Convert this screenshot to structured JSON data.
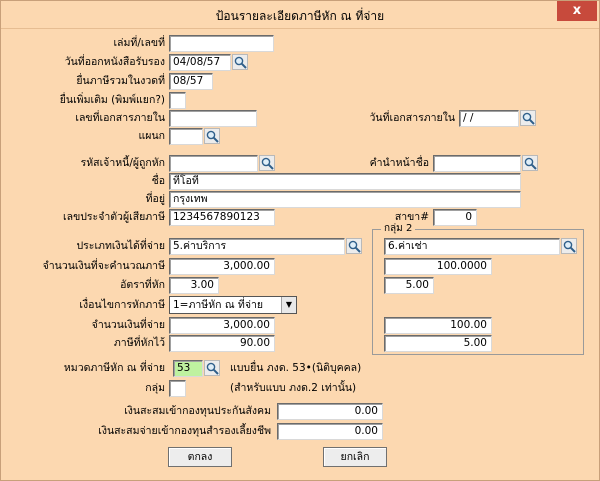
{
  "window": {
    "title": "ป้อนรายละเอียดภาษีหัก ณ ที่จ่าย",
    "close_glyph": "x"
  },
  "form": {
    "book_no": {
      "label": "เล่มที่/เลขที่",
      "value": ""
    },
    "cert_date": {
      "label": "วันที่ออกหนังสือรับรอง",
      "value": "04/08/57"
    },
    "filing_period": {
      "label": "ยื่นภาษีรวมในงวดที่",
      "value": "08/57"
    },
    "additional_filing": {
      "label": "ยื่นเพิ่มเติม (พิมพ์แยก?)",
      "value": ""
    },
    "internal_doc_no": {
      "label": "เลขที่เอกสารภายใน",
      "value": ""
    },
    "internal_doc_date": {
      "label": "วันที่เอกสารภายใน",
      "value": " / /"
    },
    "department": {
      "label": "แผนก",
      "value": ""
    },
    "payee_code": {
      "label": "รหัสเจ้าหนี้/ผู้ถูกหัก",
      "value": ""
    },
    "name_prefix": {
      "label": "คำนำหน้าชื่อ",
      "value": ""
    },
    "name": {
      "label": "ชื่อ",
      "value": "ทีโอที"
    },
    "address": {
      "label": "ที่อยู่",
      "value": "กรุงเทพ"
    },
    "tax_id": {
      "label": "เลขประจำตัวผู้เสียภาษี",
      "value": "1234567890123"
    },
    "branch": {
      "label": "สาขา#",
      "value": "0"
    },
    "income_type": {
      "label": "ประเภทเงินได้ที่จ่าย",
      "value": "5.ค่าบริการ"
    },
    "taxable_amount": {
      "label": "จำนวนเงินที่จะคำนวณภาษี",
      "value": "3,000.00"
    },
    "tax_rate": {
      "label": "อัตราที่หัก",
      "value": "3.00"
    },
    "withholding_condition": {
      "label": "เงื่อนไขการหักภาษี",
      "value": "1=ภาษีหัก ณ ที่จ่าย"
    },
    "paid_amount": {
      "label": "จำนวนเงินที่จ่าย",
      "value": "3,000.00"
    },
    "tax_withheld": {
      "label": "ภาษีที่หักไว้",
      "value": "90.00"
    },
    "tax_category": {
      "label": "หมวดภาษีหัก ณ ที่จ่าย",
      "value": "53",
      "note": "แบบยื่น ภงด. 53•(นิติบุคคล)"
    },
    "group": {
      "label": "กลุ่ม",
      "value": "",
      "note": "(สำหรับแบบ ภงด.2 เท่านั้น)"
    },
    "social_security": {
      "label": "เงินสะสมเข้ากองทุนประกันสังคม",
      "value": "0.00"
    },
    "provident_fund": {
      "label": "เงินสะสมจ่ายเข้ากองทุนสำรองเลี้ยงชีพ",
      "value": "0.00"
    }
  },
  "group2": {
    "title": "กลุ่ม 2",
    "income_type": "6.ค่าเช่า",
    "taxable_amount": "100.0000",
    "tax_rate": "5.00",
    "paid_amount": "100.00",
    "tax_withheld": "5.00"
  },
  "buttons": {
    "ok": "ตกลง",
    "cancel": "ยกเลิก"
  },
  "colors": {
    "window_bg": "#fcd8b0",
    "close_bg": "#c74a3c",
    "highlight_field": "#bff2a0"
  }
}
